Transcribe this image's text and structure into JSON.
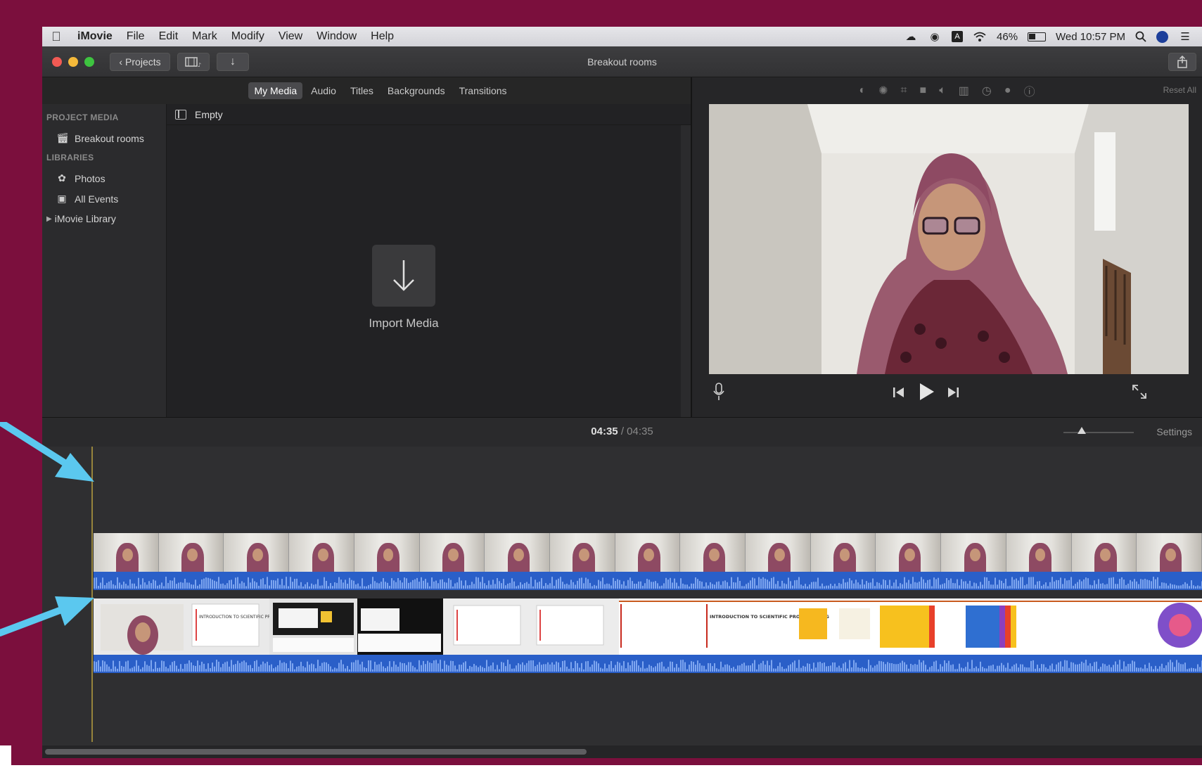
{
  "menubar": {
    "app_name": "iMovie",
    "items": [
      "File",
      "Edit",
      "Mark",
      "Modify",
      "View",
      "Window",
      "Help"
    ],
    "battery": "46%",
    "clock": "Wed 10:57 PM"
  },
  "toolbar": {
    "projects_label": "Projects",
    "window_title": "Breakout rooms"
  },
  "browser": {
    "tabs": [
      "My Media",
      "Audio",
      "Titles",
      "Backgrounds",
      "Transitions"
    ],
    "active_tab": "My Media",
    "sidebar": {
      "project_media_heading": "PROJECT MEDIA",
      "project_item": "Breakout rooms",
      "libraries_heading": "LIBRARIES",
      "photos": "Photos",
      "all_events": "All Events",
      "imovie_library": "iMovie Library"
    },
    "event_title": "Empty",
    "import_label": "Import Media"
  },
  "viewer": {
    "reset_all": "Reset All"
  },
  "timeline": {
    "current_time": "04:35",
    "separator": "/",
    "total_time": "04:35",
    "settings_label": "Settings",
    "slide_title": "INTRODUCTION TO SCIENTIFIC PROGRAMMING"
  },
  "colors": {
    "background": "#7b0f3d",
    "audio_waveform": "#2a5fc8",
    "annotation_arrow": "#5bc8ef"
  },
  "icons": [
    "apple-icon",
    "search-icon",
    "wifi-icon",
    "battery-icon",
    "share-icon",
    "import-arrow-icon",
    "microphone-icon",
    "play-icon",
    "skip-back-icon",
    "skip-forward-icon",
    "fullscreen-icon"
  ]
}
